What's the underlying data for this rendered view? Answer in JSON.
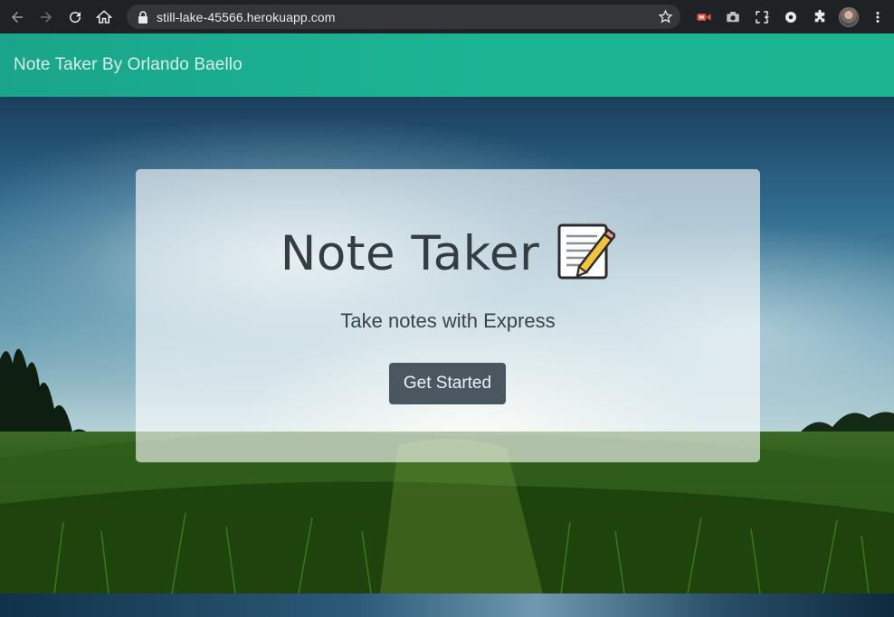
{
  "browser": {
    "url": "still-lake-45566.herokuapp.com",
    "icons": [
      "back-icon",
      "forward-icon",
      "reload-icon",
      "home-icon",
      "lock-icon",
      "star-icon",
      "extension-video-icon",
      "camera-icon",
      "screenshot-icon",
      "extension-circle-icon",
      "puzzle-icon",
      "profile-avatar",
      "more-vert-icon"
    ]
  },
  "navbar": {
    "brand": "Note Taker By Orlando Baello",
    "color": "#1bb594"
  },
  "jumbotron": {
    "title": "Note Taker",
    "title_icon": "memo-icon",
    "subtitle": "Take notes with Express",
    "button_label": "Get Started",
    "button_color": "#4a5760"
  }
}
